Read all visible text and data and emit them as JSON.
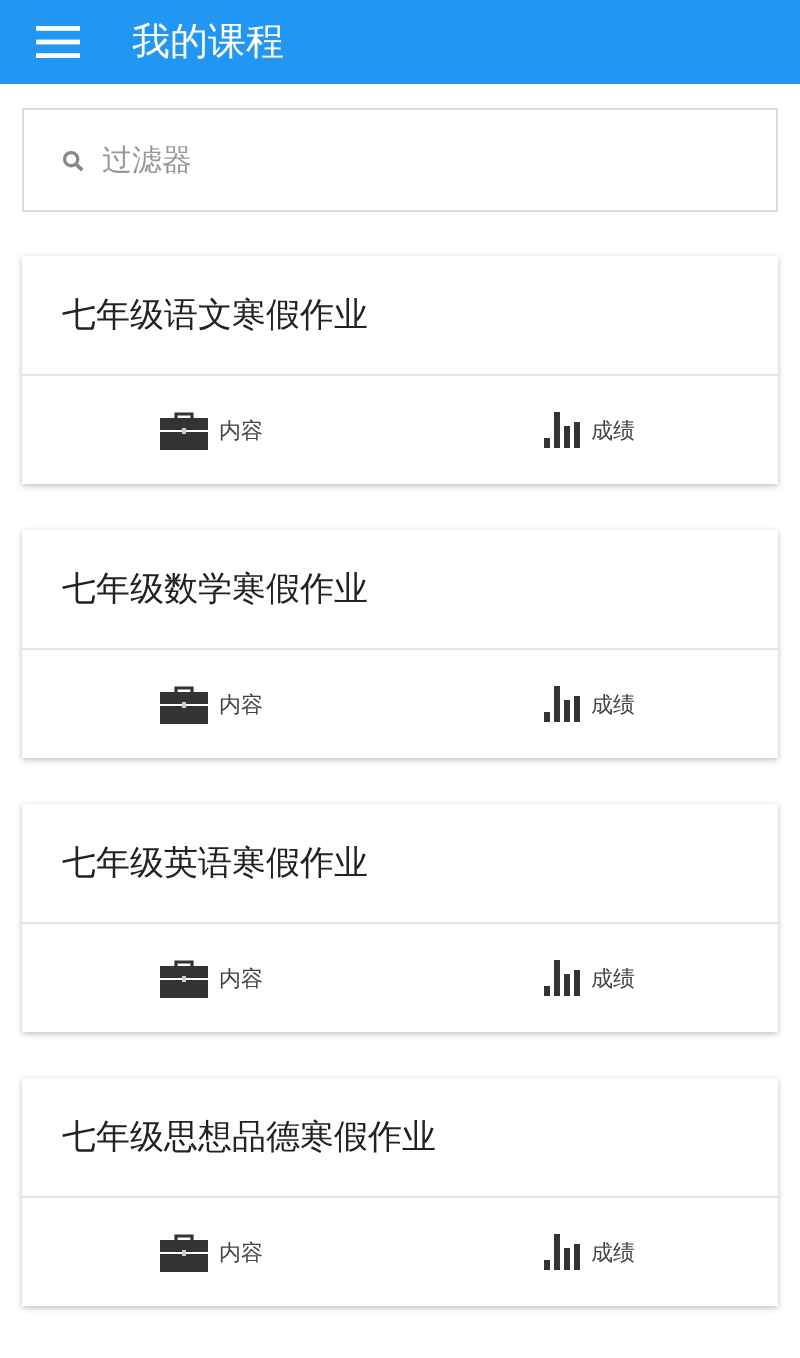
{
  "app_bar": {
    "title": "我的课程"
  },
  "filter": {
    "placeholder": "过滤器"
  },
  "courses": [
    {
      "title": "七年级语文寒假作业",
      "actions": [
        {
          "kind": "content",
          "label": "内容"
        },
        {
          "kind": "grades",
          "label": "成绩"
        }
      ]
    },
    {
      "title": "七年级数学寒假作业",
      "actions": [
        {
          "kind": "content",
          "label": "内容"
        },
        {
          "kind": "grades",
          "label": "成绩"
        }
      ]
    },
    {
      "title": "七年级英语寒假作业",
      "actions": [
        {
          "kind": "content",
          "label": "内容"
        },
        {
          "kind": "grades",
          "label": "成绩"
        }
      ]
    },
    {
      "title": "七年级思想品德寒假作业",
      "actions": [
        {
          "kind": "content",
          "label": "内容"
        },
        {
          "kind": "grades",
          "label": "成绩"
        }
      ]
    }
  ]
}
